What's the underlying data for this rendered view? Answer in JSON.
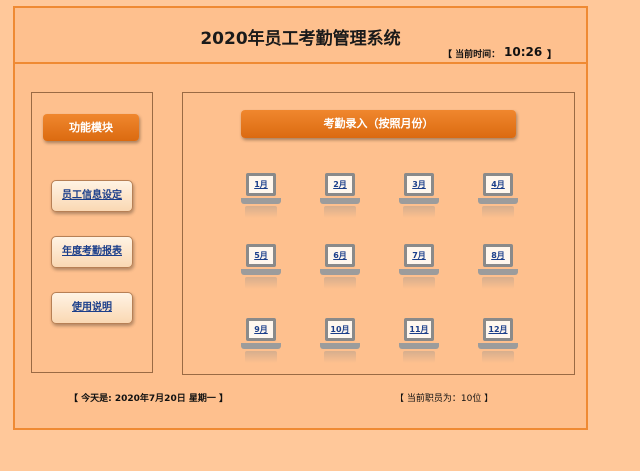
{
  "header": {
    "title": "2020年员工考勤管理系统",
    "time_label": "【 当前时间：",
    "time_value": "10:26",
    "time_close": "】"
  },
  "sidebar": {
    "header": "功能模块",
    "items": [
      {
        "label": "员工信息设定"
      },
      {
        "label": "年度考勤报表"
      },
      {
        "label": "使用说明"
      }
    ]
  },
  "main": {
    "header": "考勤录入（按照月份）",
    "months": [
      "1月",
      "2月",
      "3月",
      "4月",
      "5月",
      "6月",
      "7月",
      "8月",
      "9月",
      "10月",
      "11月",
      "12月"
    ]
  },
  "footer": {
    "date": "【 今天是: 2020年7月20日 星期一 】",
    "staff": "【 当前职员为：10位 】"
  },
  "colors": {
    "page_bg": "#FFC89A",
    "panel_bg": "#FEC08E",
    "accent": "#E8781D",
    "link": "#1B3E8A"
  },
  "icons": [
    "laptop-icon"
  ]
}
